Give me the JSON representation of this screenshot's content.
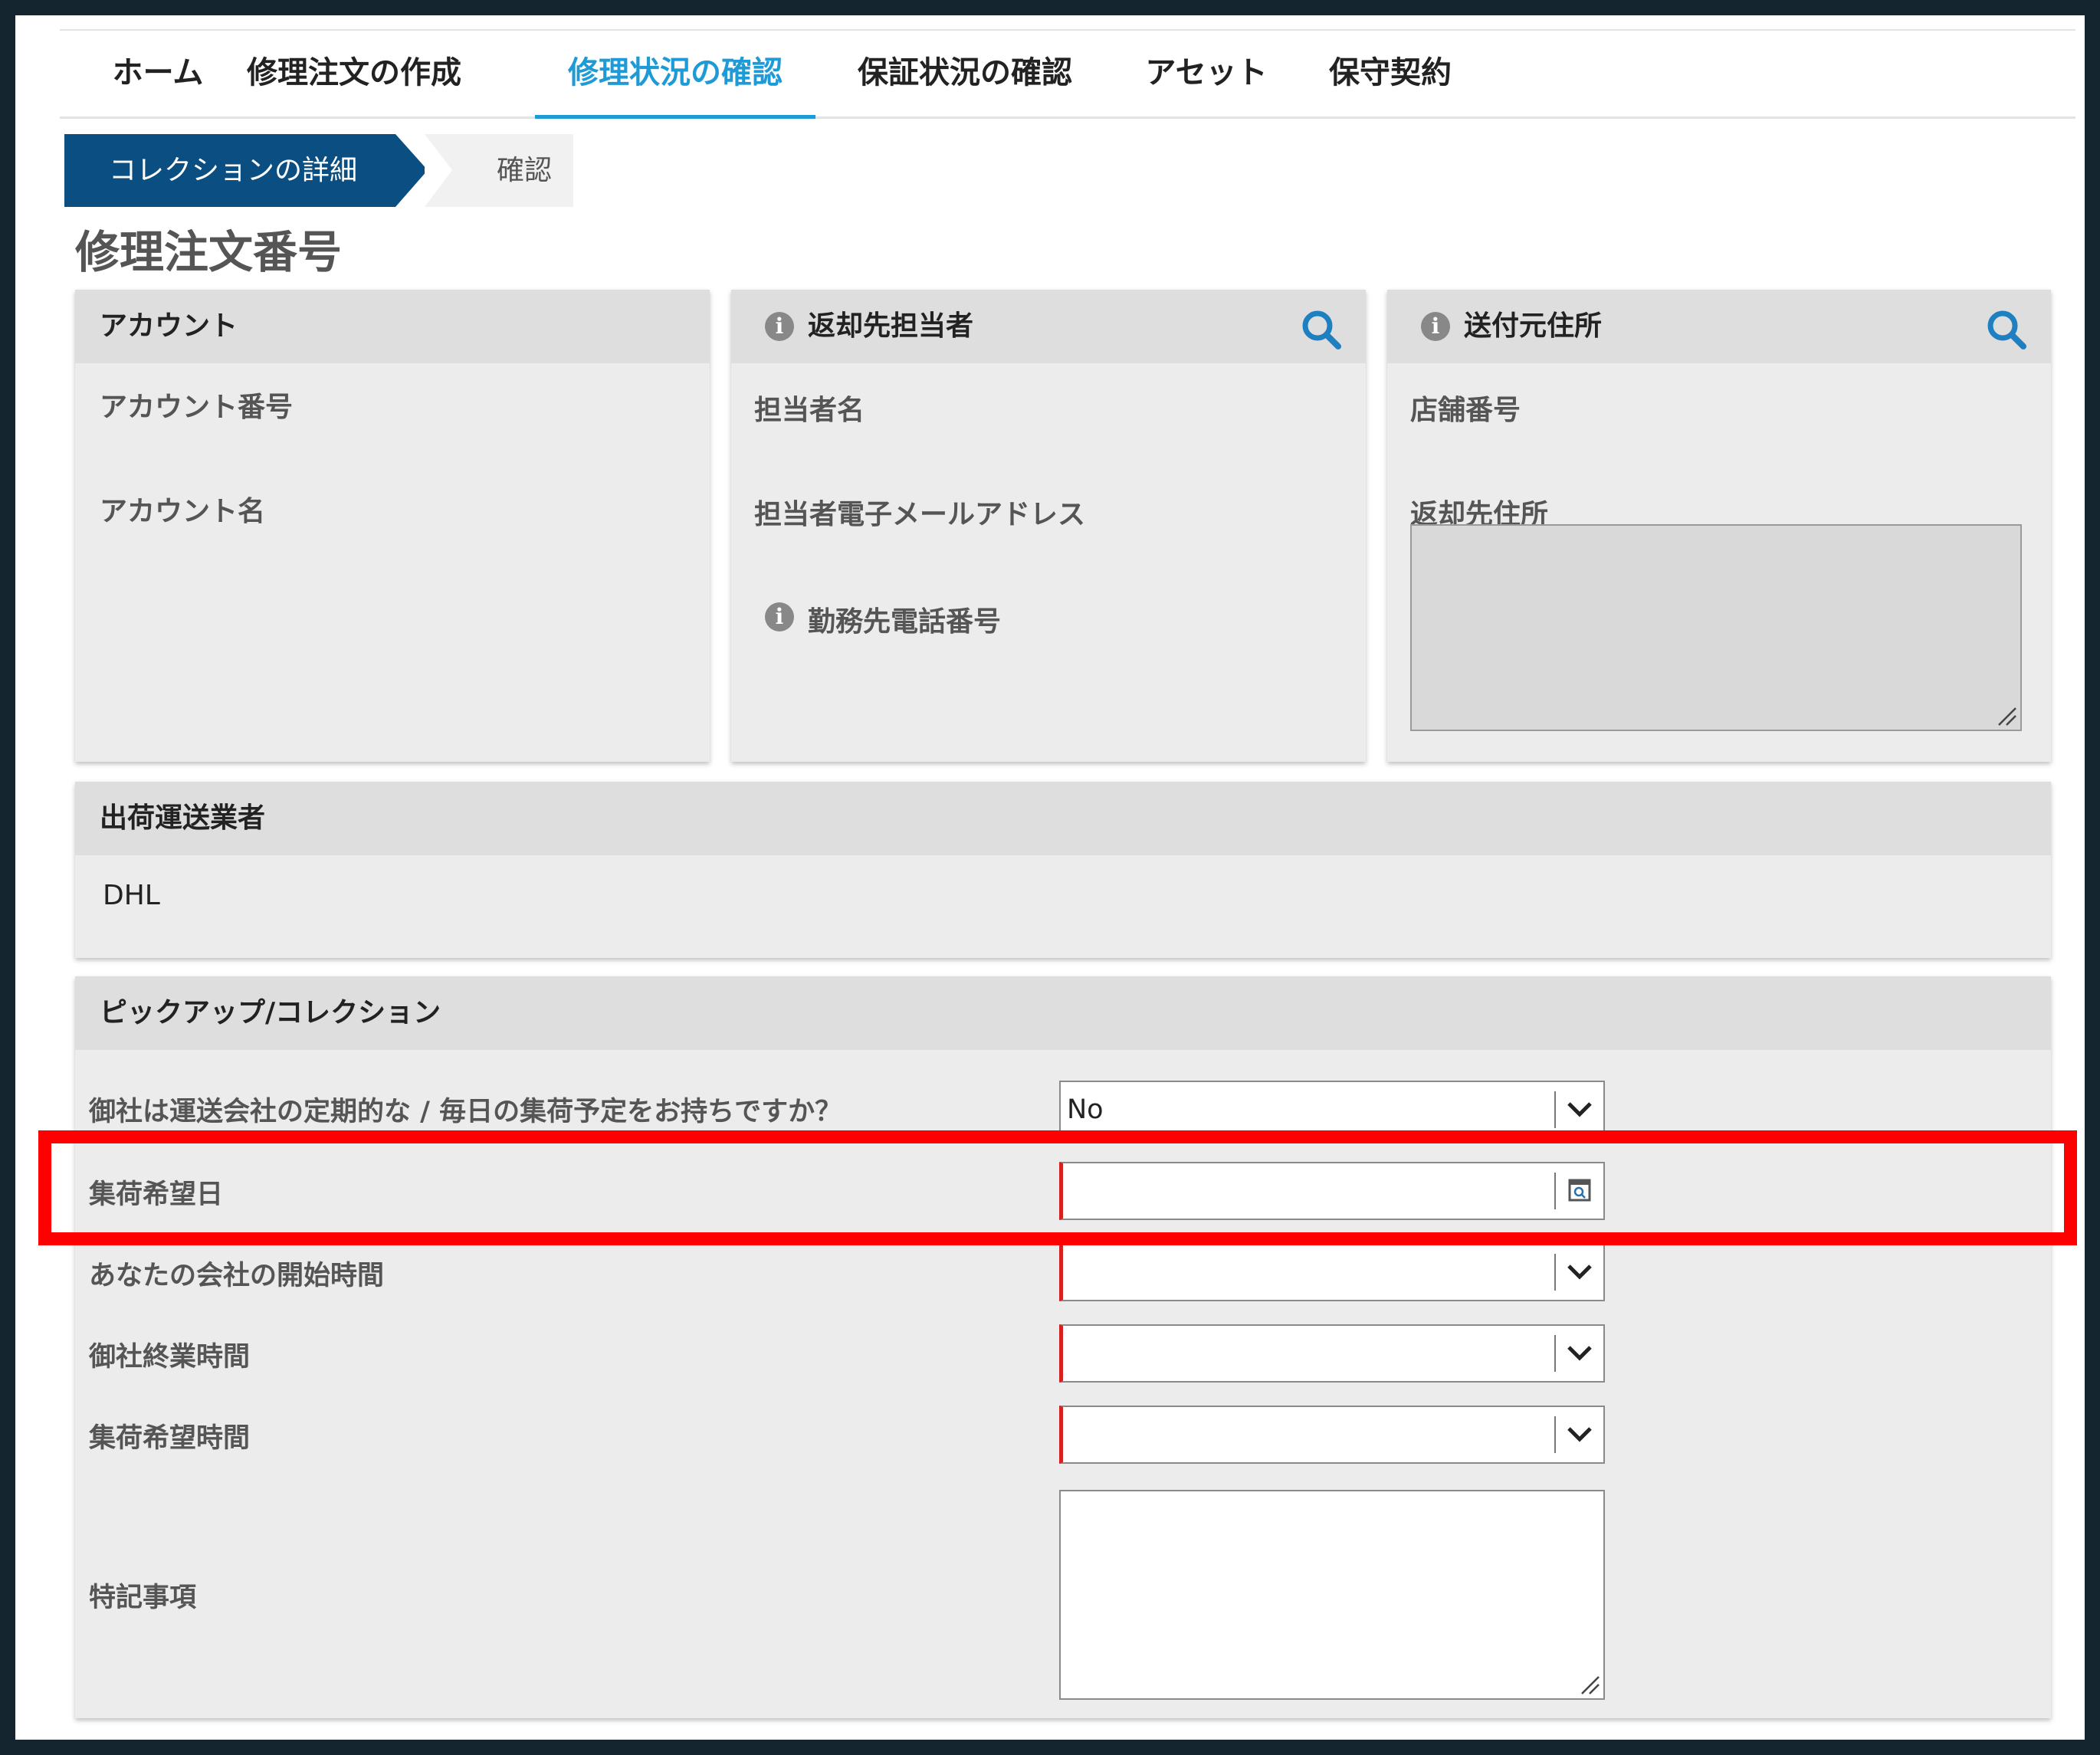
{
  "nav": {
    "tabs": [
      {
        "label": "ホーム"
      },
      {
        "label": "修理注文の作成"
      },
      {
        "label": "修理状況の確認"
      },
      {
        "label": "保証状況の確認"
      },
      {
        "label": "アセット"
      },
      {
        "label": "保守契約"
      }
    ],
    "active_tab": "修理状況の確認"
  },
  "steps": {
    "current": "コレクションの詳細",
    "next": "確認"
  },
  "page_title": "修理注文番号",
  "account_panel": {
    "title": "アカウント",
    "fields": {
      "account_number": "アカウント番号",
      "account_name": "アカウント名"
    }
  },
  "return_contact_panel": {
    "title": "返却先担当者",
    "fields": {
      "contact_name": "担当者名",
      "contact_email": "担当者電子メールアドレス",
      "work_phone": "勤務先電話番号"
    }
  },
  "ship_from_panel": {
    "title": "送付元住所",
    "fields": {
      "store_number": "店舗番号",
      "return_address": "返却先住所"
    }
  },
  "carrier_panel": {
    "title": "出荷運送業者",
    "value": "DHL"
  },
  "pickup_panel": {
    "title": "ピックアップ/コレクション",
    "rows": {
      "scheduled_pickup": {
        "label": "御社は運送会社の定期的な / 毎日の集荷予定をお持ちですか？",
        "value": "No"
      },
      "pickup_date": {
        "label": "集荷希望日",
        "value": ""
      },
      "open_time": {
        "label": "あなたの会社の開始時間",
        "value": ""
      },
      "close_time": {
        "label": "御社終業時間",
        "value": ""
      },
      "pickup_time": {
        "label": "集荷希望時間",
        "value": ""
      },
      "notes": {
        "label": "特記事項",
        "value": ""
      }
    }
  },
  "colors": {
    "accent": "#1e9ad6",
    "step_active": "#0b4e82",
    "required": "#d62020",
    "highlight": "#ff0000",
    "frame": "#14252f"
  },
  "icons": [
    "search-icon",
    "info-icon",
    "chevron-down-icon",
    "calendar-icon",
    "resize-grip-icon"
  ]
}
